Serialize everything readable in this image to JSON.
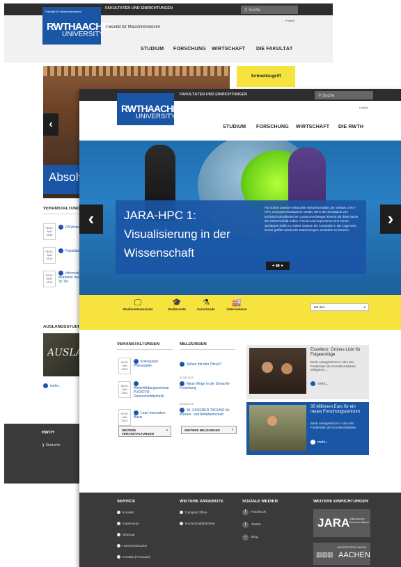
{
  "back": {
    "topbar_label": "FAKULTÄTEN UND EINRICHTUNGEN",
    "search_label": "Suche",
    "english_label": "English",
    "logo_small": "Fakultät für Maschinenwesen",
    "logo_main": "RWTHAACHEN",
    "logo_sub": "UNIVERSITY",
    "faculty_title": "Fakultät für Maschinenwesen",
    "nav": [
      "STUDIUM",
      "FORSCHUNG",
      "WIRTSCHAFT",
      "DIE FAKULTÄT"
    ],
    "quick_access": "Schnellzugriff",
    "hero_text": "Absolv",
    "events_heading": "VERANSTALTUNGEN",
    "events": [
      {
        "date": "08.05. MAI 2012",
        "title": "PA Weiterb"
      },
      {
        "date": "08.05. MAI 2012",
        "title": "Fakultätsk"
      },
      {
        "date": "23.04. APR 2012",
        "title": "Informatio Markenst das 3x Tre"
      }
    ],
    "abroad_heading": "AUSLANDSSTUDIUM",
    "abroad_image_text": "AUSLAN",
    "more": "mehr...",
    "footer_heading": "RWTH",
    "footer_link": "Startseite"
  },
  "front": {
    "topbar_label": "FAKULTÄTEN UND EINRICHTUNGEN",
    "search_label": "Suche",
    "english_label": "English",
    "logo_main": "RWTHAACHEN",
    "logo_sub": "UNIVERSITY",
    "nav": [
      "STUDIUM",
      "FORSCHUNG",
      "WIRTSCHAFT",
      "DIE RWTH"
    ],
    "hero": {
      "title_line1": "JARA-HPC 1:",
      "title_line2": "Visualisierung in der",
      "title_line3": "Wissenschaft",
      "description": "Für solche Zwecke entwickeln Wissenschaftler der Sektion JARA-HPC Computersimulationen weiter, denn der Simulation von technisch-physikalischen Zusammenhängen kommt als dritte Säule der Wissenschaft neben Theorie und Experiment eine immer wichtigere Rolle zu. Daher müssen die Anwender in der Lage sein, immer größer werdende Datenmengen verstehen zu können.",
      "pager": "◄ ▮▮ ►"
    },
    "audiences": [
      {
        "label": "Studieninteressierte",
        "icon": "monitor-icon"
      },
      {
        "label": "Studierende",
        "icon": "graduation-cap-icon"
      },
      {
        "label": "Forschende",
        "icon": "flask-icon"
      },
      {
        "label": "Unternehmen",
        "icon": "factory-icon"
      }
    ],
    "select_value": "Mit dem",
    "events_heading": "VERANSTALTUNGEN",
    "events": [
      {
        "date": "10.05. MAI 2012",
        "title": "Kolloquium Philosophie"
      },
      {
        "date": "08.05. MAI 2012",
        "title": "Weiterbildungsseminar PVD/CVD-Dünnschichttechnik"
      },
      {
        "date": "09.05. MAI 2012",
        "title": "Lean Innovation Basis"
      }
    ],
    "events_button": "WEITERE VERANSTALTUNGEN",
    "news_heading": "MELDUNGEN",
    "news": [
      {
        "date": "",
        "title": "Sehen mit den Ohren?"
      },
      {
        "date": "02.05.2012",
        "title": "Neue Wege in der Sensorik-Forschung"
      },
      {
        "date": "09.05.2012",
        "title": "46. ESSENER TAGUNG für Wasser- und Abfallwirtschaft"
      }
    ],
    "news_button": "WEITERE MELDUNGEN",
    "teaser1": {
      "title": "Exzellenz: Grünes Licht für Folgeanträge",
      "text": "Beide Antragsskizzen in den drei Förderlinien der Exzellenzinitiative erfolgreich ...",
      "more": "mehr..."
    },
    "teaser2": {
      "title": "35 Millionen Euro für ein neues Forschungszentrum",
      "text": "Beide Antragsskizzen in den drei Förderlinien der Exzellenzinitiative.",
      "more": "mehr..."
    },
    "footer": {
      "service_heading": "SERVICE",
      "service_links": [
        "Kontakt",
        "Impressum",
        "Sitemap",
        "Hochschulsuche",
        "Kontakt (Formular)"
      ],
      "offers_heading": "WEITERE ANGEBOTE",
      "offers_links": [
        "Campus Office",
        "Hochschulbibliothek"
      ],
      "social_heading": "SOZIALE MEDIEN",
      "social_links": [
        "Facebook",
        "Twitter",
        "Blog"
      ],
      "institutions_heading": "WEITERE EINRICHTUNGEN",
      "jara_logo": "JARA",
      "jara_sub": "Jülich Aachen Research Alliance",
      "aachen_logo": "AACHEN",
      "aachen_sub": "UNIVERSITÄTSKLINIKUM"
    }
  },
  "colors": {
    "rwth_blue": "#1b56a6",
    "yellow": "#f6e33e",
    "dark": "#3a3a3a",
    "topbar": "#2d2d2d"
  }
}
